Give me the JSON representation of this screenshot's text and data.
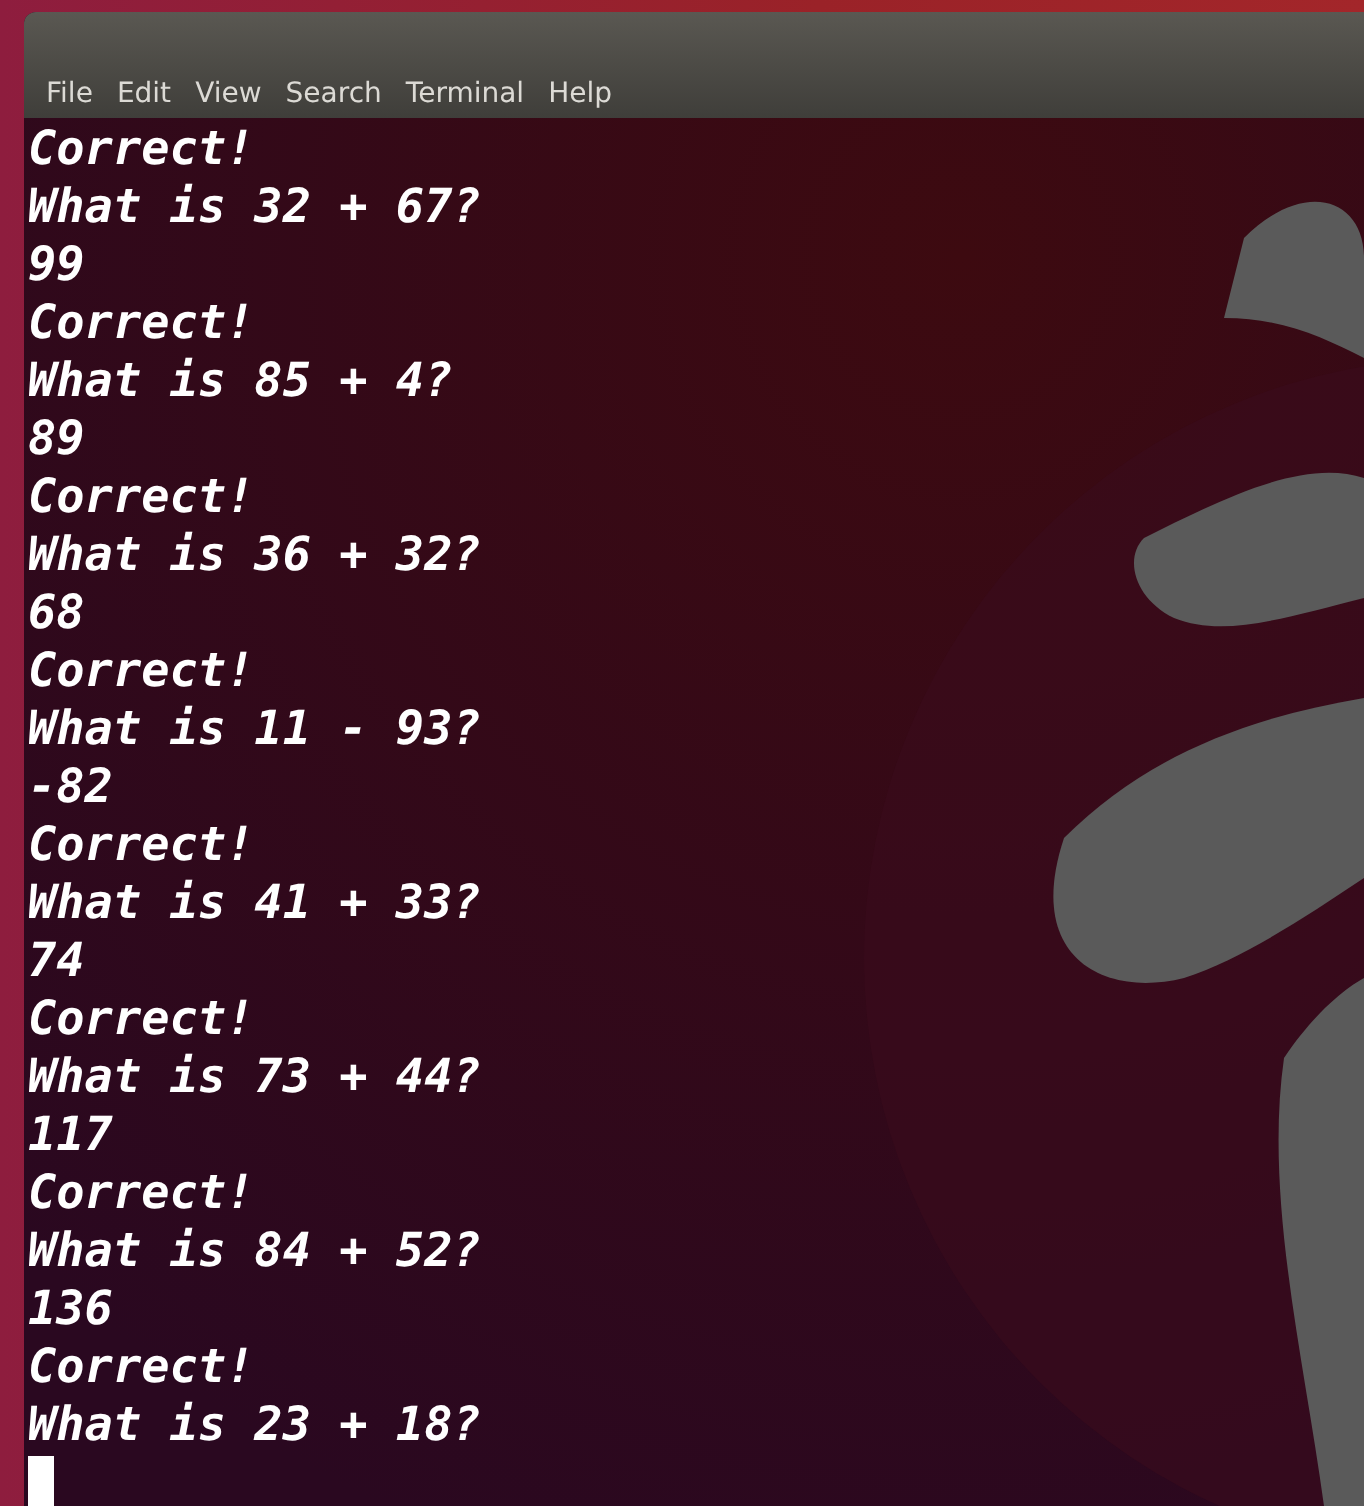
{
  "menu": [
    "File",
    "Edit",
    "View",
    "Search",
    "Terminal",
    "Help"
  ],
  "lines": [
    "Correct!",
    "What is 32 + 67?",
    "99",
    "Correct!",
    "What is 85 + 4?",
    "89",
    "Correct!",
    "What is 36 + 32?",
    "68",
    "Correct!",
    "What is 11 - 93?",
    "-82",
    "Correct!",
    "What is 41 + 33?",
    "74",
    "Correct!",
    "What is 73 + 44?",
    "117",
    "Correct!",
    "What is 84 + 52?",
    "136",
    "Correct!",
    "What is 23 + 18?"
  ]
}
